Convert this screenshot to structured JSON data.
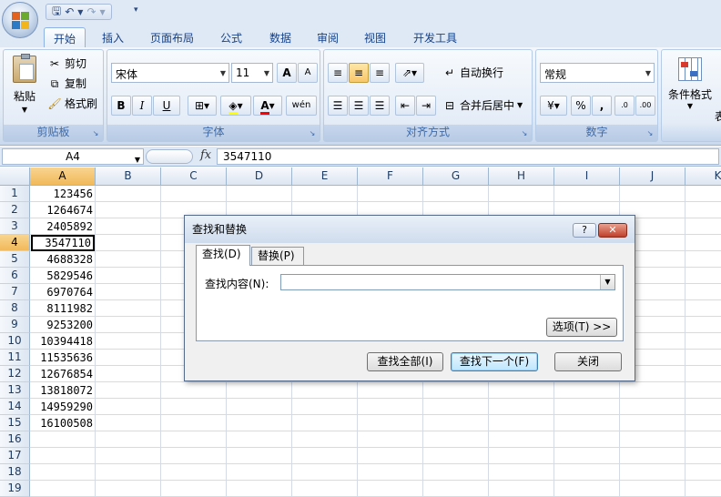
{
  "quick_access": {
    "icons": [
      "save-icon",
      "undo-icon",
      "redo-icon",
      "customize-icon"
    ]
  },
  "tabs": [
    {
      "label": "开始",
      "active": true
    },
    {
      "label": "插入"
    },
    {
      "label": "页面布局"
    },
    {
      "label": "公式"
    },
    {
      "label": "数据"
    },
    {
      "label": "审阅"
    },
    {
      "label": "视图"
    },
    {
      "label": "开发工具"
    }
  ],
  "ribbon": {
    "clipboard": {
      "label": "剪贴板",
      "paste": "粘贴",
      "cut": "剪切",
      "copy": "复制",
      "format_painter": "格式刷"
    },
    "font": {
      "label": "字体",
      "font_name": "宋体",
      "font_size": "11",
      "grow": "A",
      "shrink": "A",
      "bold": "B",
      "italic": "I",
      "underline": "U",
      "phonetic": "wén"
    },
    "alignment": {
      "label": "对齐方式",
      "wrap_text": "自动换行",
      "merge_center": "合并后居中"
    },
    "number": {
      "label": "数字",
      "format": "常规",
      "percent": "%",
      "comma": ",",
      "inc_decimal": ".0",
      "dec_decimal": ".00"
    },
    "styles": {
      "conditional_format": "条件格式",
      "overflow": "表"
    }
  },
  "formula_bar": {
    "name_box": "A4",
    "fx": "fx",
    "value": "3547110"
  },
  "sheet": {
    "columns": [
      "A",
      "B",
      "C",
      "D",
      "E",
      "F",
      "G",
      "H",
      "I",
      "J",
      "K"
    ],
    "rows": [
      "1",
      "2",
      "3",
      "4",
      "5",
      "6",
      "7",
      "8",
      "9",
      "10",
      "11",
      "12",
      "13",
      "14",
      "15",
      "16",
      "17",
      "18",
      "19"
    ],
    "active_row": "4",
    "active_col": "A",
    "values_a": [
      "123456",
      "1264674",
      "2405892",
      "3547110",
      "4688328",
      "5829546",
      "6970764",
      "8111982",
      "9253200",
      "10394418",
      "11535636",
      "12676854",
      "13818072",
      "14959290",
      "16100508"
    ]
  },
  "dialog": {
    "title": "查找和替换",
    "help": "?",
    "close": "✕",
    "tab_find": "查找(D)",
    "tab_replace": "替换(P)",
    "find_label": "查找内容(N):",
    "find_value": "",
    "options_button": "选项(T) >>",
    "find_all_button": "查找全部(I)",
    "find_next_button": "查找下一个(F)",
    "close_button": "关闭"
  },
  "colors": {
    "accent": "#15428b",
    "ribbon_bg": "#dfe9f5",
    "selected_header": "#f1b95a"
  }
}
